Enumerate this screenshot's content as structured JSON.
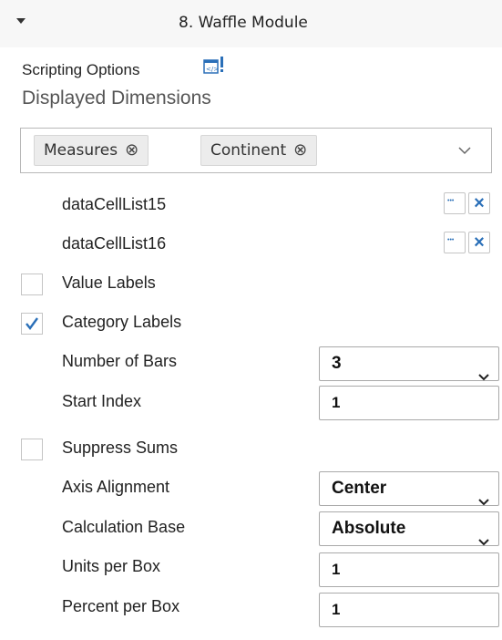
{
  "header": {
    "title": "8. Waffle Module",
    "collapse_icon": "caret-down-icon"
  },
  "scripting": {
    "label": "Scripting Options",
    "icon": "script-code-icon"
  },
  "dimensions": {
    "heading": "Displayed Dimensions",
    "chips": [
      {
        "label": "Measures"
      },
      {
        "label": "Continent"
      }
    ],
    "remove_icon": "⊗"
  },
  "cell_lists": [
    {
      "label": "dataCellList15"
    },
    {
      "label": "dataCellList16"
    }
  ],
  "options": {
    "value_labels": {
      "label": "Value Labels",
      "checked": false
    },
    "category_labels": {
      "label": "Category Labels",
      "checked": true
    },
    "number_of_bars": {
      "label": "Number of Bars",
      "value": "3"
    },
    "start_index": {
      "label": "Start Index",
      "value": "1"
    },
    "suppress_sums": {
      "label": "Suppress Sums",
      "checked": false
    },
    "axis_alignment": {
      "label": "Axis Alignment",
      "value": "Center"
    },
    "calculation_base": {
      "label": "Calculation Base",
      "value": "Absolute"
    },
    "units_per_box": {
      "label": "Units per Box",
      "value": "1"
    },
    "percent_per_box": {
      "label": "Percent per Box",
      "value": "1"
    }
  },
  "colors": {
    "accent": "#2a6fb8",
    "header_bg": "#f7f7f7"
  }
}
